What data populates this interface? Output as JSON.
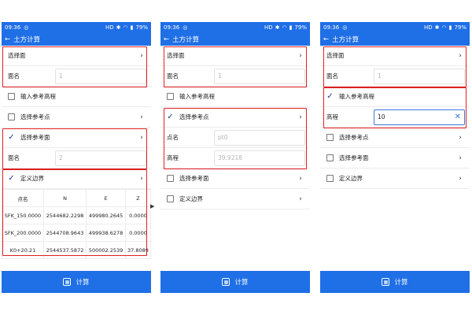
{
  "status": {
    "time": "09:36",
    "battery": "79%",
    "badge": "HD"
  },
  "app": {
    "title": "土方计算",
    "back_icon": "arrow-left-icon"
  },
  "labels": {
    "select_surface": "选择面",
    "surface_name": "面名",
    "input_ref_elev": "输入参考高程",
    "select_ref_point": "选择参考点",
    "select_ref_surface": "选择参考面",
    "define_boundary": "定义边界",
    "point_name": "点名",
    "elevation": "高程",
    "calculate": "计算"
  },
  "screen1": {
    "surface_name_value": "1",
    "ref_surface_name_value": "2",
    "table": {
      "headers": [
        "点名",
        "N",
        "E",
        "Z"
      ],
      "rows": [
        [
          "SFK_150.0000",
          "2544682.2298",
          "499980.2645",
          "0.0000"
        ],
        [
          "SFK_200.0000",
          "2544708.9643",
          "499938.6278",
          "0.0000"
        ],
        [
          "K0+20.21",
          "2544537.5872",
          "500002.2539",
          "37.8089"
        ]
      ]
    }
  },
  "screen2": {
    "surface_name_value": "1",
    "point_name_value": "pt0",
    "elevation_value": "39.9218"
  },
  "screen3": {
    "surface_name_value": "1",
    "elevation_value": "10"
  }
}
